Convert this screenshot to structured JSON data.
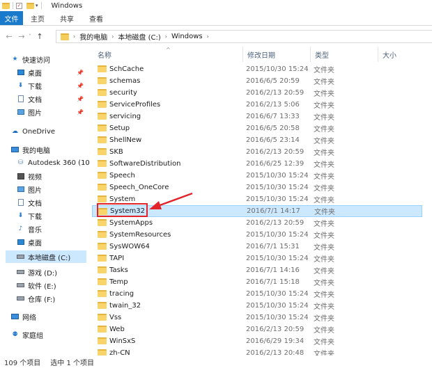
{
  "window": {
    "title": "Windows"
  },
  "ribbon": {
    "tabs": [
      "文件",
      "主页",
      "共享",
      "查看"
    ]
  },
  "address": {
    "crumbs": [
      "我的电脑",
      "本地磁盘 (C:)",
      "Windows"
    ]
  },
  "nav": {
    "quick_access": "快速访问",
    "quick_items": [
      {
        "label": "桌面",
        "icon": "desktop-icon"
      },
      {
        "label": "下载",
        "icon": "download-icon"
      },
      {
        "label": "文档",
        "icon": "document-icon"
      },
      {
        "label": "图片",
        "icon": "picture-icon"
      }
    ],
    "onedrive": "OneDrive",
    "this_pc": "我的电脑",
    "pc_items": [
      {
        "label": "Autodesk 360 (10",
        "icon": "cloud-drive-icon"
      },
      {
        "label": "视频",
        "icon": "video-icon"
      },
      {
        "label": "图片",
        "icon": "picture-icon"
      },
      {
        "label": "文档",
        "icon": "document-icon"
      },
      {
        "label": "下载",
        "icon": "download-icon"
      },
      {
        "label": "音乐",
        "icon": "music-icon"
      },
      {
        "label": "桌面",
        "icon": "desktop-icon"
      },
      {
        "label": "本地磁盘 (C:)",
        "icon": "drive-icon"
      },
      {
        "label": "游戏 (D:)",
        "icon": "drive-icon"
      },
      {
        "label": "软件 (E:)",
        "icon": "drive-icon"
      },
      {
        "label": "仓库 (F:)",
        "icon": "drive-icon"
      }
    ],
    "network": "网络",
    "homegroup": "家庭组"
  },
  "columns": {
    "name": "名称",
    "date": "修改日期",
    "type": "类型",
    "size": "大小"
  },
  "files": [
    {
      "name": "SchCache",
      "date": "2015/10/30 15:24",
      "type": "文件夹"
    },
    {
      "name": "schemas",
      "date": "2016/6/5 20:59",
      "type": "文件夹"
    },
    {
      "name": "security",
      "date": "2016/2/13 20:59",
      "type": "文件夹"
    },
    {
      "name": "ServiceProfiles",
      "date": "2016/2/13 5:06",
      "type": "文件夹"
    },
    {
      "name": "servicing",
      "date": "2016/6/7 13:33",
      "type": "文件夹"
    },
    {
      "name": "Setup",
      "date": "2016/6/5 20:58",
      "type": "文件夹"
    },
    {
      "name": "ShellNew",
      "date": "2016/6/5 23:14",
      "type": "文件夹"
    },
    {
      "name": "SKB",
      "date": "2016/2/13 20:59",
      "type": "文件夹"
    },
    {
      "name": "SoftwareDistribution",
      "date": "2016/6/25 12:39",
      "type": "文件夹"
    },
    {
      "name": "Speech",
      "date": "2015/10/30 15:24",
      "type": "文件夹"
    },
    {
      "name": "Speech_OneCore",
      "date": "2015/10/30 15:24",
      "type": "文件夹"
    },
    {
      "name": "System",
      "date": "2015/10/30 15:24",
      "type": "文件夹"
    },
    {
      "name": "System32",
      "date": "2016/7/1 14:17",
      "type": "文件夹",
      "selected": true
    },
    {
      "name": "SystemApps",
      "date": "2016/2/13 20:59",
      "type": "文件夹"
    },
    {
      "name": "SystemResources",
      "date": "2015/10/30 15:24",
      "type": "文件夹"
    },
    {
      "name": "SysWOW64",
      "date": "2016/7/1 15:31",
      "type": "文件夹"
    },
    {
      "name": "TAPI",
      "date": "2015/10/30 15:24",
      "type": "文件夹"
    },
    {
      "name": "Tasks",
      "date": "2016/7/1 14:16",
      "type": "文件夹"
    },
    {
      "name": "Temp",
      "date": "2016/7/1 15:18",
      "type": "文件夹"
    },
    {
      "name": "tracing",
      "date": "2015/10/30 15:24",
      "type": "文件夹"
    },
    {
      "name": "twain_32",
      "date": "2015/10/30 15:24",
      "type": "文件夹"
    },
    {
      "name": "Vss",
      "date": "2015/10/30 15:24",
      "type": "文件夹"
    },
    {
      "name": "Web",
      "date": "2016/2/13 20:59",
      "type": "文件夹"
    },
    {
      "name": "WinSxS",
      "date": "2016/6/29 19:34",
      "type": "文件夹"
    },
    {
      "name": "zh-CN",
      "date": "2016/2/13 20:48",
      "type": "文件夹"
    }
  ],
  "status": {
    "count": "109 个项目",
    "selected": "选中 1 个项目"
  },
  "colors": {
    "accent": "#1979ca",
    "selection": "#cce8ff",
    "folder": "#f8d46a",
    "annotation": "#e2242a"
  }
}
